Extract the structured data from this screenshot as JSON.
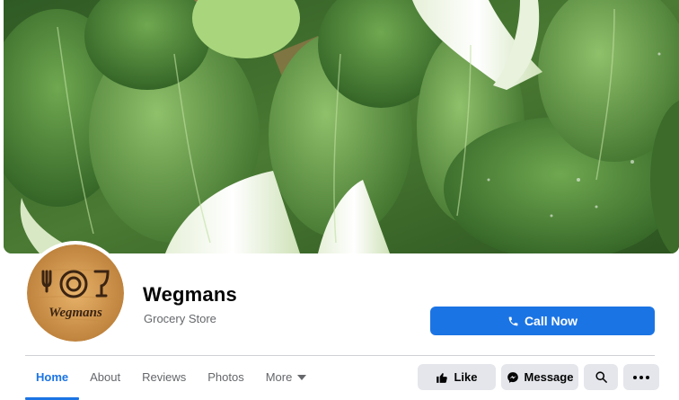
{
  "page": {
    "name": "Wegmans",
    "category": "Grocery Store"
  },
  "avatar": {
    "logo_text": "Wegmans"
  },
  "cta": {
    "label": "Call Now",
    "icon": "phone-icon"
  },
  "tabs": [
    {
      "label": "Home",
      "active": true
    },
    {
      "label": "About",
      "active": false
    },
    {
      "label": "Reviews",
      "active": false
    },
    {
      "label": "Photos",
      "active": false
    },
    {
      "label": "More",
      "active": false,
      "icon": "caret-down-icon"
    }
  ],
  "actions": {
    "like_label": "Like",
    "like_icon": "thumbs-up-icon",
    "message_label": "Message",
    "message_icon": "messenger-icon",
    "search_icon": "search-icon",
    "more_icon": "ellipsis-icon"
  },
  "colors": {
    "accent": "#1b74e4",
    "button_gray": "#e4e6eb",
    "secondary_text": "#65676b",
    "divider": "#ced0d4"
  }
}
